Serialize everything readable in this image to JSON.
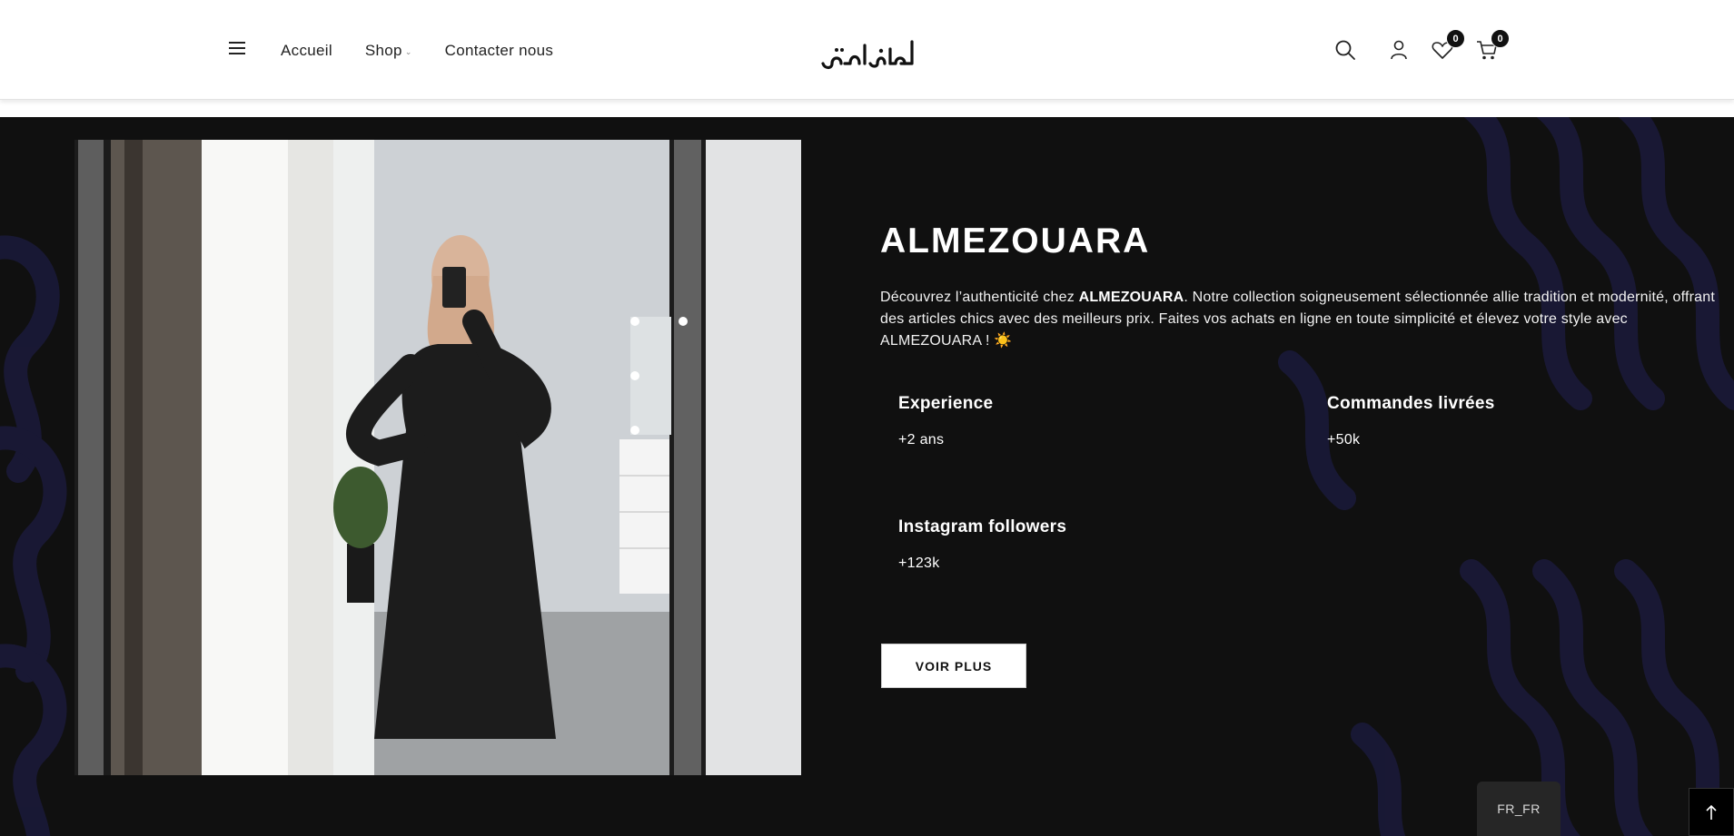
{
  "header": {
    "nav": [
      {
        "label": "Accueil"
      },
      {
        "label": "Shop",
        "has_dropdown": true
      },
      {
        "label": "Contacter nous"
      }
    ],
    "logo_alt": "المزوارة",
    "wishlist_count": "0",
    "cart_count": "0"
  },
  "hero": {
    "title": "ALMEZOUARA",
    "description": {
      "part1": "Découvrez l’authenticité chez ",
      "brand": "ALMEZOUARA",
      "part2": ". Notre collection soigneusement sélectionnée allie tradition et modernité, offrant des articles chics avec des meilleurs prix. Faites vos achats en ligne en toute simplicité et élevez votre style avec ALMEZOUARA ! ☀️"
    },
    "stats": [
      {
        "label": "Experience",
        "value": "+2 ans"
      },
      {
        "label": "Commandes livrées",
        "value": "+50k"
      },
      {
        "label": "Instagram followers",
        "value": "+123k"
      }
    ],
    "cta_label": "VOIR PLUS"
  },
  "footer_controls": {
    "language": "FR_FR"
  },
  "colors": {
    "hero_bg": "#101010",
    "pattern": "#1c1b3a",
    "accent": "#ffffff"
  }
}
